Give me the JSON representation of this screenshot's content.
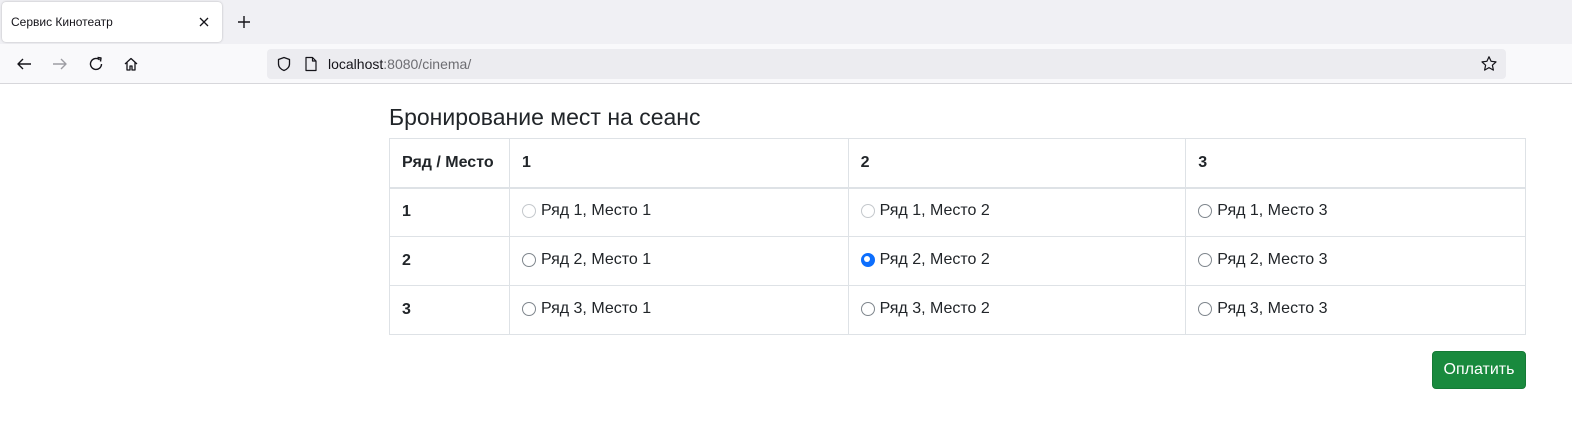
{
  "browser": {
    "tab_title": "Сервис Кинотеатр",
    "url_host": "localhost",
    "url_path": ":8080/cinema/"
  },
  "page": {
    "title": "Бронирование мест на сеанс",
    "corner_header": "Ряд / Место",
    "columns": [
      "1",
      "2",
      "3"
    ],
    "rows": [
      {
        "label": "1",
        "seats": [
          {
            "label": "Ряд 1, Место 1",
            "state": "disabled"
          },
          {
            "label": "Ряд 1, Место 2",
            "state": "disabled"
          },
          {
            "label": "Ряд 1, Место 3",
            "state": "available"
          }
        ]
      },
      {
        "label": "2",
        "seats": [
          {
            "label": "Ряд 2, Место 1",
            "state": "available"
          },
          {
            "label": "Ряд 2, Место 2",
            "state": "checked"
          },
          {
            "label": "Ряд 2, Место 3",
            "state": "available"
          }
        ]
      },
      {
        "label": "3",
        "seats": [
          {
            "label": "Ряд 3, Место 1",
            "state": "available"
          },
          {
            "label": "Ряд 3, Место 2",
            "state": "available"
          },
          {
            "label": "Ряд 3, Место 3",
            "state": "available"
          }
        ]
      }
    ],
    "pay_button": "Оплатить"
  },
  "colors": {
    "accent": "#0d6efd",
    "pay_button": "#198a3e"
  },
  "icons": [
    "close-icon",
    "plus-icon",
    "back-arrow-icon",
    "forward-arrow-icon",
    "reload-icon",
    "home-icon",
    "shield-icon",
    "page-icon",
    "star-icon"
  ]
}
